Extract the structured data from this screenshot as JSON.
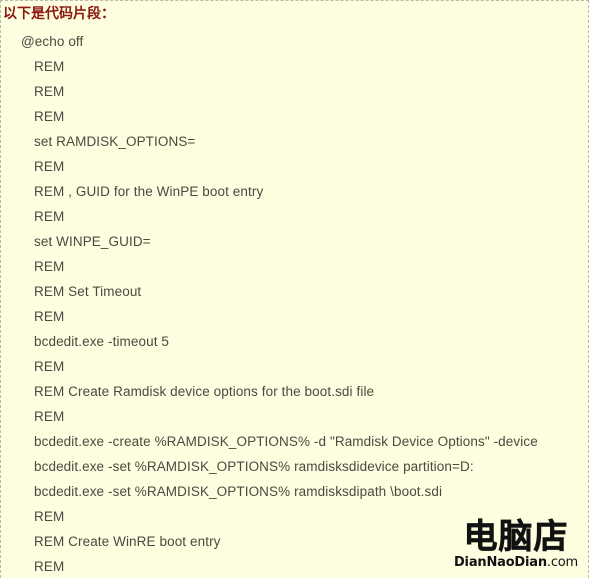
{
  "panel": {
    "heading": "以下是代码片段：",
    "background_color": "#fdfde0",
    "heading_color": "#8b1a10",
    "text_color": "#4a4a42",
    "border_color": "#b9b9a8"
  },
  "code": {
    "lines": [
      {
        "text": "@echo off",
        "indent": 0
      },
      {
        "text": "REM",
        "indent": 1
      },
      {
        "text": "REM",
        "indent": 1
      },
      {
        "text": "REM",
        "indent": 1
      },
      {
        "text": "set RAMDISK_OPTIONS=",
        "indent": 1
      },
      {
        "text": "REM",
        "indent": 1
      },
      {
        "text": "REM , GUID for the WinPE boot entry",
        "indent": 1
      },
      {
        "text": "REM",
        "indent": 1
      },
      {
        "text": "set WINPE_GUID=",
        "indent": 1
      },
      {
        "text": "REM",
        "indent": 1
      },
      {
        "text": "REM Set Timeout",
        "indent": 1
      },
      {
        "text": "REM",
        "indent": 1
      },
      {
        "text": "bcdedit.exe -timeout 5",
        "indent": 1
      },
      {
        "text": "REM",
        "indent": 1
      },
      {
        "text": "REM Create Ramdisk device options for the boot.sdi file",
        "indent": 1
      },
      {
        "text": "REM",
        "indent": 1
      },
      {
        "text": "bcdedit.exe -create %RAMDISK_OPTIONS% -d \"Ramdisk Device Options\" -device",
        "indent": 1
      },
      {
        "text": "bcdedit.exe -set %RAMDISK_OPTIONS% ramdisksdidevice partition=D:",
        "indent": 1
      },
      {
        "text": "bcdedit.exe -set %RAMDISK_OPTIONS% ramdisksdipath \\boot.sdi",
        "indent": 1
      },
      {
        "text": "REM",
        "indent": 1
      },
      {
        "text": "REM Create WinRE boot entry",
        "indent": 1
      },
      {
        "text": "REM",
        "indent": 1
      }
    ]
  },
  "watermark": {
    "logo_cjk": "电脑店",
    "domain_bold": "DianNaoDian",
    "domain_suffix": ".com"
  }
}
